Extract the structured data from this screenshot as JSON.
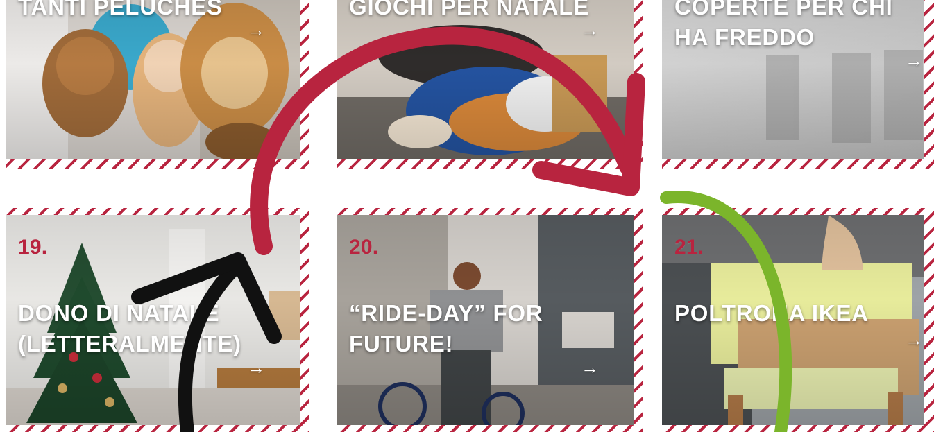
{
  "cards": [
    {
      "title": "TANTI PELUCHES",
      "number": "",
      "arrow": "→"
    },
    {
      "title": "GIOCHI PER NATALE",
      "number": "",
      "arrow": "→"
    },
    {
      "title": "COPERTE PER CHI HA FREDDO",
      "number": "",
      "arrow": "→"
    },
    {
      "title": "DONO DI NATALE (LETTERALMENTE)",
      "number": "19.",
      "arrow": "→"
    },
    {
      "title": "“RIDE-DAY” FOR FUTURE!",
      "number": "20.",
      "arrow": "→"
    },
    {
      "title": "POLTRONA IKEA",
      "number": "21.",
      "arrow": "→"
    }
  ],
  "colors": {
    "accent": "#b8243f",
    "annotation_black": "#111111",
    "annotation_green": "#7bb52b"
  }
}
